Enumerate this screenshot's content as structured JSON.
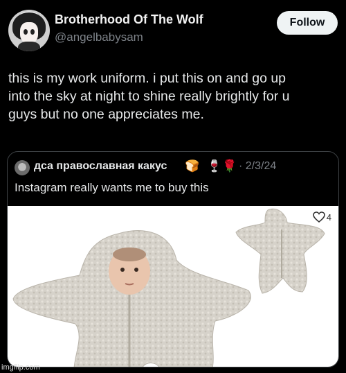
{
  "header": {
    "display_name": "Brotherhood Of The Wolf",
    "handle": "@angelbabysam",
    "follow_label": "Follow"
  },
  "tweet": {
    "lines": [
      "this is my work uniform. i put this on and go up",
      "into the sky at night to shine really brightly for u",
      "guys but no one appreciates me."
    ]
  },
  "quote": {
    "name": "дса православная какус",
    "emojis": [
      "🍞",
      "🍷",
      "🌹"
    ],
    "date": "· 2/3/24",
    "text": "Instagram really wants me to buy this",
    "like_count": "4"
  },
  "watermark": "imgflip.com",
  "colors": {
    "background": "#000000",
    "follow_button": "#eff3f4",
    "muted_text": "#7d8288",
    "border": "#3c4043",
    "suit_fleece": "#d6d2ca"
  },
  "icons": [
    "avatar-image",
    "heart-icon"
  ]
}
